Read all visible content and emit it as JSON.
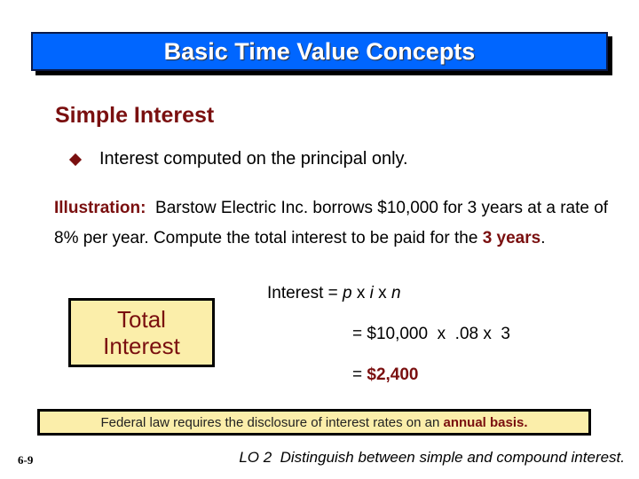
{
  "slide": {
    "title": "Basic Time Value Concepts",
    "section_heading": "Simple Interest",
    "bullet": "Interest computed on the principal only.",
    "illustration": {
      "label": "Illustration:",
      "text_1": "Barstow Electric Inc. borrows $10,000 for 3 years at a rate of 8% per year.  Compute the total interest to be paid for the",
      "highlight": "3 years",
      "text_end": "."
    },
    "total_box": {
      "line_1": "Total",
      "line_2": "Interest"
    },
    "formula": {
      "line_1_prefix": "Interest = ",
      "var_p": "p",
      "x1": " x ",
      "var_i": "i",
      "x2": " x ",
      "var_n": "n",
      "line_2": "= $10,000  x  .08 x  3",
      "line_3_prefix": "= ",
      "result": "$2,400"
    },
    "banner": {
      "text": "Federal law requires the disclosure of interest rates on an ",
      "highlight": "annual basis."
    },
    "page_number": "6-9",
    "learning_objective": "LO 2  Distinguish between simple and compound interest."
  },
  "colors": {
    "title_bar": "#0066ff",
    "accent_maroon": "#7a0f0f",
    "box_yellow": "#fbeeaa"
  }
}
